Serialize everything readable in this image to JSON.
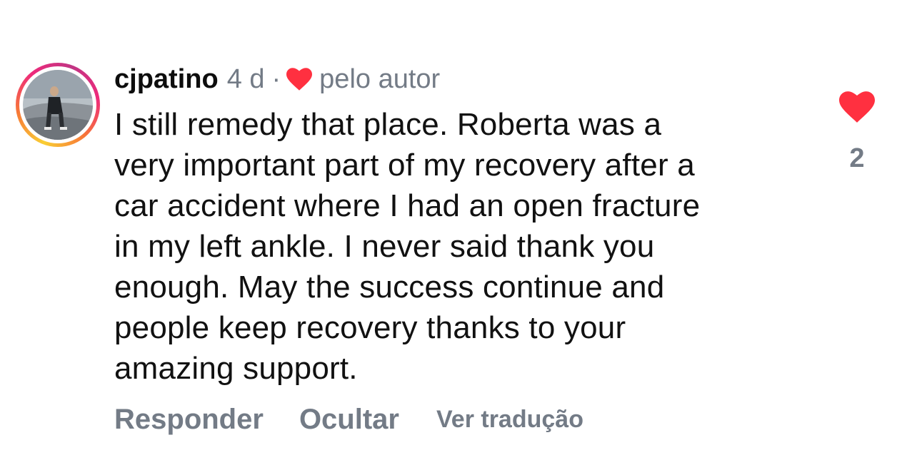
{
  "comment": {
    "username": "cjpatino",
    "age": "4 d",
    "separator": "·",
    "liked_by_author_label": "pelo autor",
    "text_lines": [
      "I still remedy that place. Roberta was a",
      "very important part of my recovery after a",
      "car accident where I had an open fracture",
      "in my left ankle. I never said thank you",
      "enough. May the success continue and",
      "people keep recovery thanks to your",
      "amazing support."
    ],
    "like_count": "2"
  },
  "actions": {
    "reply_label": "Responder",
    "hide_label": "Ocultar",
    "translate_label": "Ver tradução"
  },
  "colors": {
    "heart": "#ff3040",
    "secondary_text": "#737b86",
    "primary_text": "#0d0d0d"
  },
  "icons": {
    "author_like": "heart-filled-icon",
    "like": "heart-filled-icon"
  }
}
